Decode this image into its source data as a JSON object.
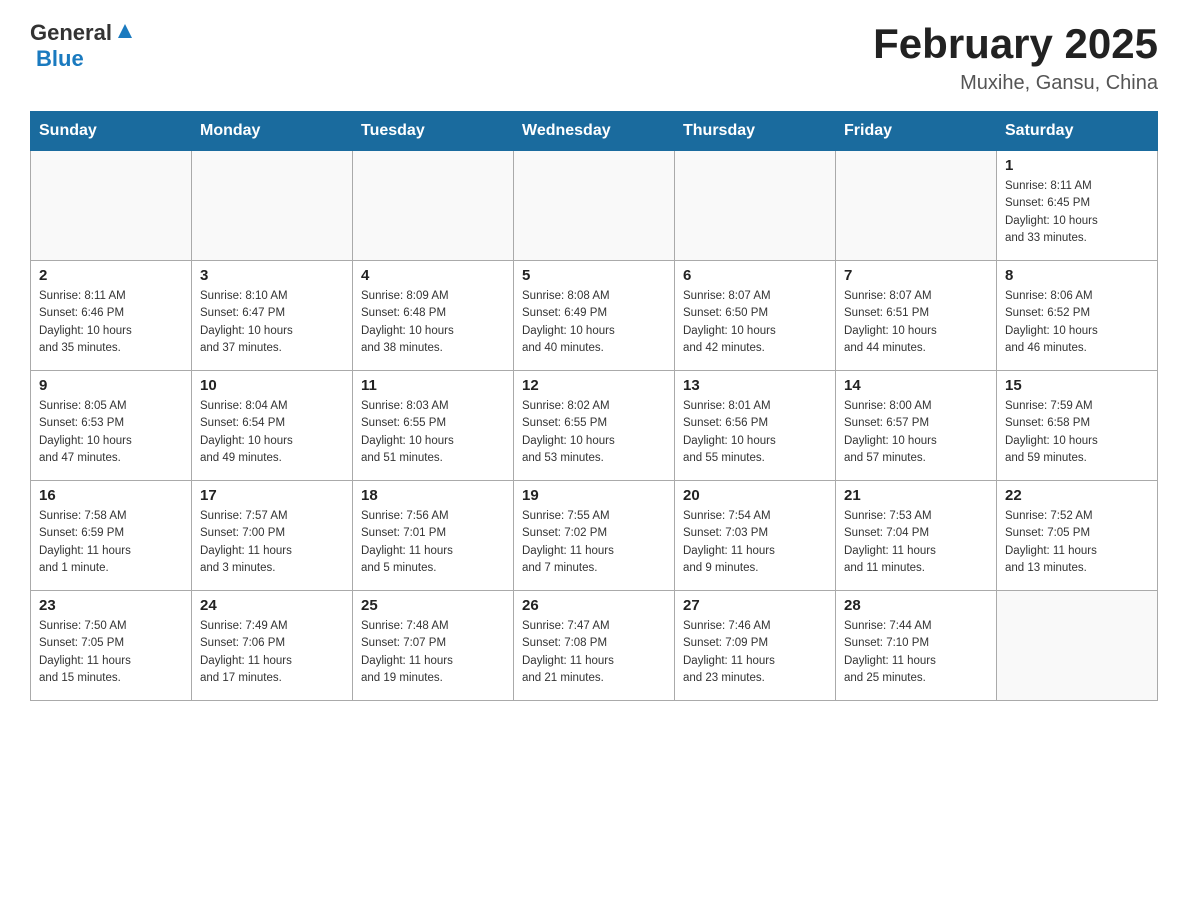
{
  "header": {
    "logo_general": "General",
    "logo_blue": "Blue",
    "title": "February 2025",
    "subtitle": "Muxihe, Gansu, China"
  },
  "weekdays": [
    "Sunday",
    "Monday",
    "Tuesday",
    "Wednesday",
    "Thursday",
    "Friday",
    "Saturday"
  ],
  "weeks": [
    [
      {
        "day": "",
        "info": ""
      },
      {
        "day": "",
        "info": ""
      },
      {
        "day": "",
        "info": ""
      },
      {
        "day": "",
        "info": ""
      },
      {
        "day": "",
        "info": ""
      },
      {
        "day": "",
        "info": ""
      },
      {
        "day": "1",
        "info": "Sunrise: 8:11 AM\nSunset: 6:45 PM\nDaylight: 10 hours\nand 33 minutes."
      }
    ],
    [
      {
        "day": "2",
        "info": "Sunrise: 8:11 AM\nSunset: 6:46 PM\nDaylight: 10 hours\nand 35 minutes."
      },
      {
        "day": "3",
        "info": "Sunrise: 8:10 AM\nSunset: 6:47 PM\nDaylight: 10 hours\nand 37 minutes."
      },
      {
        "day": "4",
        "info": "Sunrise: 8:09 AM\nSunset: 6:48 PM\nDaylight: 10 hours\nand 38 minutes."
      },
      {
        "day": "5",
        "info": "Sunrise: 8:08 AM\nSunset: 6:49 PM\nDaylight: 10 hours\nand 40 minutes."
      },
      {
        "day": "6",
        "info": "Sunrise: 8:07 AM\nSunset: 6:50 PM\nDaylight: 10 hours\nand 42 minutes."
      },
      {
        "day": "7",
        "info": "Sunrise: 8:07 AM\nSunset: 6:51 PM\nDaylight: 10 hours\nand 44 minutes."
      },
      {
        "day": "8",
        "info": "Sunrise: 8:06 AM\nSunset: 6:52 PM\nDaylight: 10 hours\nand 46 minutes."
      }
    ],
    [
      {
        "day": "9",
        "info": "Sunrise: 8:05 AM\nSunset: 6:53 PM\nDaylight: 10 hours\nand 47 minutes."
      },
      {
        "day": "10",
        "info": "Sunrise: 8:04 AM\nSunset: 6:54 PM\nDaylight: 10 hours\nand 49 minutes."
      },
      {
        "day": "11",
        "info": "Sunrise: 8:03 AM\nSunset: 6:55 PM\nDaylight: 10 hours\nand 51 minutes."
      },
      {
        "day": "12",
        "info": "Sunrise: 8:02 AM\nSunset: 6:55 PM\nDaylight: 10 hours\nand 53 minutes."
      },
      {
        "day": "13",
        "info": "Sunrise: 8:01 AM\nSunset: 6:56 PM\nDaylight: 10 hours\nand 55 minutes."
      },
      {
        "day": "14",
        "info": "Sunrise: 8:00 AM\nSunset: 6:57 PM\nDaylight: 10 hours\nand 57 minutes."
      },
      {
        "day": "15",
        "info": "Sunrise: 7:59 AM\nSunset: 6:58 PM\nDaylight: 10 hours\nand 59 minutes."
      }
    ],
    [
      {
        "day": "16",
        "info": "Sunrise: 7:58 AM\nSunset: 6:59 PM\nDaylight: 11 hours\nand 1 minute."
      },
      {
        "day": "17",
        "info": "Sunrise: 7:57 AM\nSunset: 7:00 PM\nDaylight: 11 hours\nand 3 minutes."
      },
      {
        "day": "18",
        "info": "Sunrise: 7:56 AM\nSunset: 7:01 PM\nDaylight: 11 hours\nand 5 minutes."
      },
      {
        "day": "19",
        "info": "Sunrise: 7:55 AM\nSunset: 7:02 PM\nDaylight: 11 hours\nand 7 minutes."
      },
      {
        "day": "20",
        "info": "Sunrise: 7:54 AM\nSunset: 7:03 PM\nDaylight: 11 hours\nand 9 minutes."
      },
      {
        "day": "21",
        "info": "Sunrise: 7:53 AM\nSunset: 7:04 PM\nDaylight: 11 hours\nand 11 minutes."
      },
      {
        "day": "22",
        "info": "Sunrise: 7:52 AM\nSunset: 7:05 PM\nDaylight: 11 hours\nand 13 minutes."
      }
    ],
    [
      {
        "day": "23",
        "info": "Sunrise: 7:50 AM\nSunset: 7:05 PM\nDaylight: 11 hours\nand 15 minutes."
      },
      {
        "day": "24",
        "info": "Sunrise: 7:49 AM\nSunset: 7:06 PM\nDaylight: 11 hours\nand 17 minutes."
      },
      {
        "day": "25",
        "info": "Sunrise: 7:48 AM\nSunset: 7:07 PM\nDaylight: 11 hours\nand 19 minutes."
      },
      {
        "day": "26",
        "info": "Sunrise: 7:47 AM\nSunset: 7:08 PM\nDaylight: 11 hours\nand 21 minutes."
      },
      {
        "day": "27",
        "info": "Sunrise: 7:46 AM\nSunset: 7:09 PM\nDaylight: 11 hours\nand 23 minutes."
      },
      {
        "day": "28",
        "info": "Sunrise: 7:44 AM\nSunset: 7:10 PM\nDaylight: 11 hours\nand 25 minutes."
      },
      {
        "day": "",
        "info": ""
      }
    ]
  ]
}
